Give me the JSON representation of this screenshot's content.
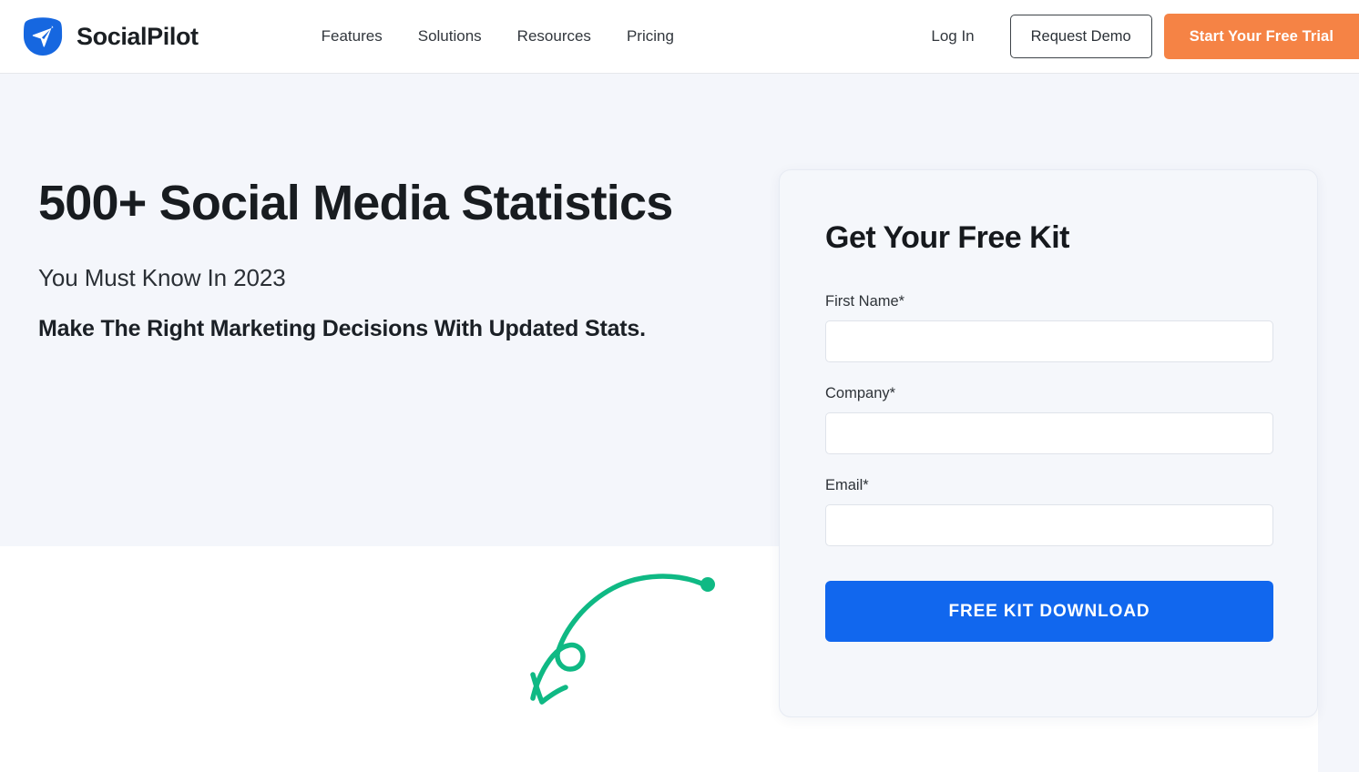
{
  "header": {
    "brand": {
      "name": "SocialPilot",
      "logo_icon": "paper-plane-logo-icon",
      "logo_color": "#1667e0"
    },
    "nav": [
      {
        "label": "Features"
      },
      {
        "label": "Solutions"
      },
      {
        "label": "Resources"
      },
      {
        "label": "Pricing"
      }
    ],
    "login_label": "Log In",
    "demo_label": "Request Demo",
    "trial_label": "Start Your Free Trial",
    "trial_color": "#f58345"
  },
  "hero": {
    "title": "500+ Social Media Statistics",
    "subtitle": "You Must Know In 2023",
    "tagline": "Make The Right Marketing Decisions With Updated Stats.",
    "arrow_icon": "curved-arrow-icon",
    "arrow_color": "#0fb984",
    "background_color": "#f4f6fb"
  },
  "form": {
    "title": "Get Your Free Kit",
    "fields": [
      {
        "label": "First Name*",
        "value": "",
        "placeholder": ""
      },
      {
        "label": "Company*",
        "value": "",
        "placeholder": ""
      },
      {
        "label": "Email*",
        "value": "",
        "placeholder": ""
      }
    ],
    "submit_label": "FREE KIT DOWNLOAD",
    "submit_color": "#1167ee"
  }
}
